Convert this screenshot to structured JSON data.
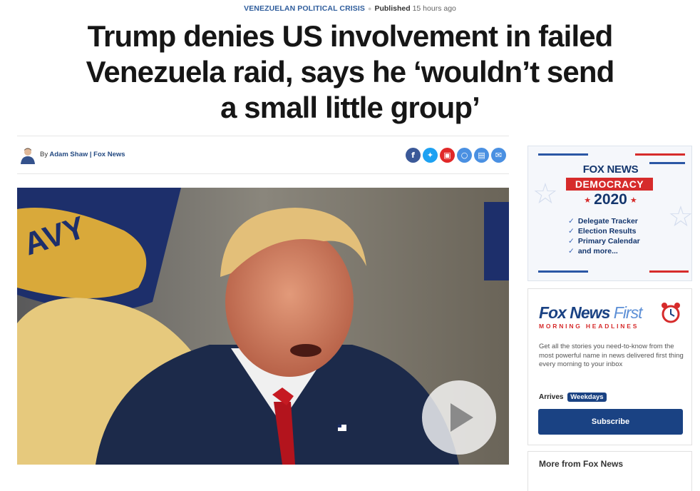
{
  "kicker": {
    "topic": "VENEZUELAN POLITICAL CRISIS",
    "published_label": "Published",
    "published_ago": "15 hours ago"
  },
  "headline": "Trump denies US involvement in failed Venezuela raid, says he ‘wouldn’t send a small little group’",
  "byline": {
    "by": "By",
    "author": "Adam Shaw | Fox News"
  },
  "share_icons": [
    "facebook-icon",
    "twitter-icon",
    "flipboard-icon",
    "comment-icon",
    "print-icon",
    "email-icon"
  ],
  "hero": {
    "flag_text": "AVY",
    "play_icon": "play-icon"
  },
  "ad_democracy": {
    "brand": "FOX NEWS",
    "badge": "DEMOCRACY",
    "year": "2020",
    "items": [
      "Delegate Tracker",
      "Election Results",
      "Primary Calendar",
      "and more..."
    ]
  },
  "ad_first": {
    "logo_main": "Fox News",
    "logo_first": "First",
    "subtitle": "MORNING HEADLINES",
    "description": "Get all the stories you need-to-know from the most powerful name in news delivered first thing every morning to your inbox",
    "arrives_label": "Arrives",
    "arrives_value": "Weekdays",
    "subscribe_label": "Subscribe"
  },
  "more_box": {
    "title": "More from Fox News"
  },
  "colors": {
    "navy": "#1a4283",
    "red": "#d62b2b",
    "kicker_blue": "#2f5d9c",
    "facebook": "#3b5998",
    "twitter": "#1da1f2",
    "flipboard": "#e12828",
    "share_blue": "#4a90e2"
  }
}
